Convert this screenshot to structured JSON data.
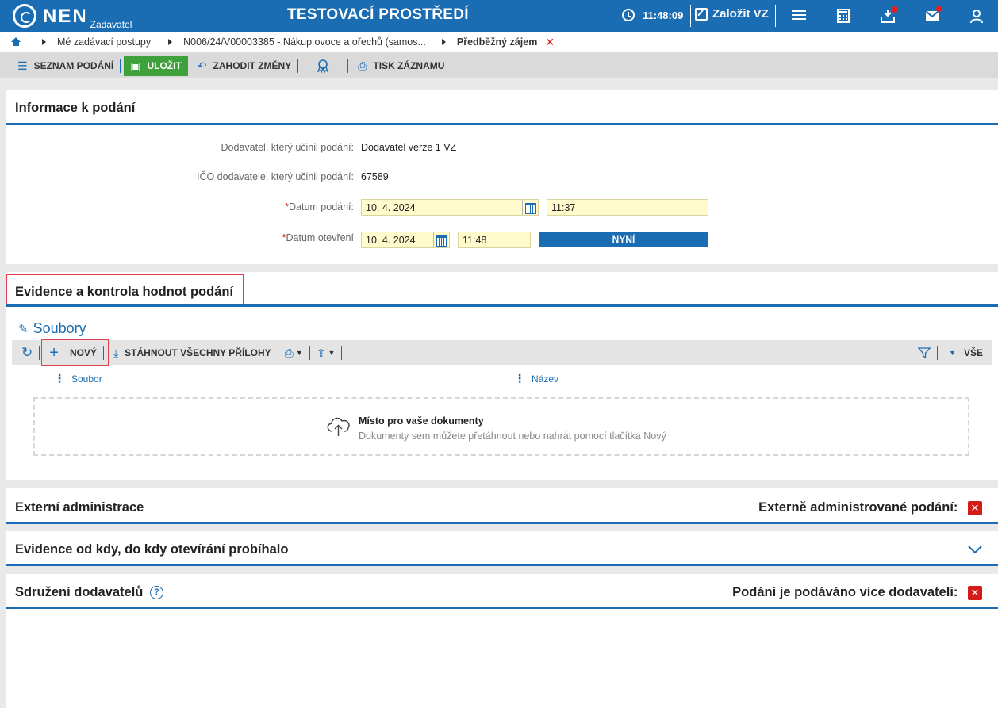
{
  "topbar": {
    "logo_text": "NEN",
    "role": "Zadavatel",
    "env_title": "TESTOVACÍ PROSTŘEDÍ",
    "time": "11:48:09",
    "new_tender_label": "Založit VZ"
  },
  "breadcrumb": {
    "items": [
      "Mé zadávací postupy",
      "N006/24/V00003385 - Nákup ovoce a ořechů (samos...",
      "Předběžný zájem"
    ]
  },
  "toolbar": {
    "list_label": "SEZNAM PODÁNÍ",
    "save_label": "ULOŽIT",
    "discard_label": "ZAHODIT ZMĚNY",
    "print_label": "TISK ZÁZNAMU"
  },
  "info": {
    "title": "Informace k podání",
    "supplier_label": "Dodavatel, který učinil podání:",
    "supplier_value": "Dodavatel verze 1 VZ",
    "ico_label": "IČO dodavatele, který učinil podání:",
    "ico_value": "67589",
    "submit_date_label": "Datum podání:",
    "submit_date": "10. 4. 2024",
    "submit_time": "11:37",
    "open_date_label": "Datum otevření",
    "open_date": "10. 4. 2024",
    "open_time": "11:48",
    "now_label": "NYNÍ"
  },
  "evidence": {
    "title": "Evidence a kontrola hodnot podání",
    "files_title": "Soubory",
    "new_label": "NOVÝ",
    "download_all_label": "STÁHNOUT VŠECHNY PŘÍLOHY",
    "filter_all_label": "VŠE",
    "col_file": "Soubor",
    "col_name": "Název",
    "dropzone_title": "Místo pro vaše dokumenty",
    "dropzone_sub": "Dokumenty sem můžete přetáhnout nebo nahrát pomocí tlačítka Nový"
  },
  "external": {
    "title": "Externí administrace",
    "right_label": "Externě administrované podání:"
  },
  "opening": {
    "title": "Evidence od kdy, do kdy otevírání probíhalo"
  },
  "association": {
    "title": "Sdružení dodavatelů",
    "right_label": "Podání je podáváno více dodavateli:"
  },
  "colors": {
    "primary": "#1b6db3",
    "save_green": "#3fa13c",
    "required_red": "#d51a1a",
    "input_yellow": "#fffbcc"
  }
}
